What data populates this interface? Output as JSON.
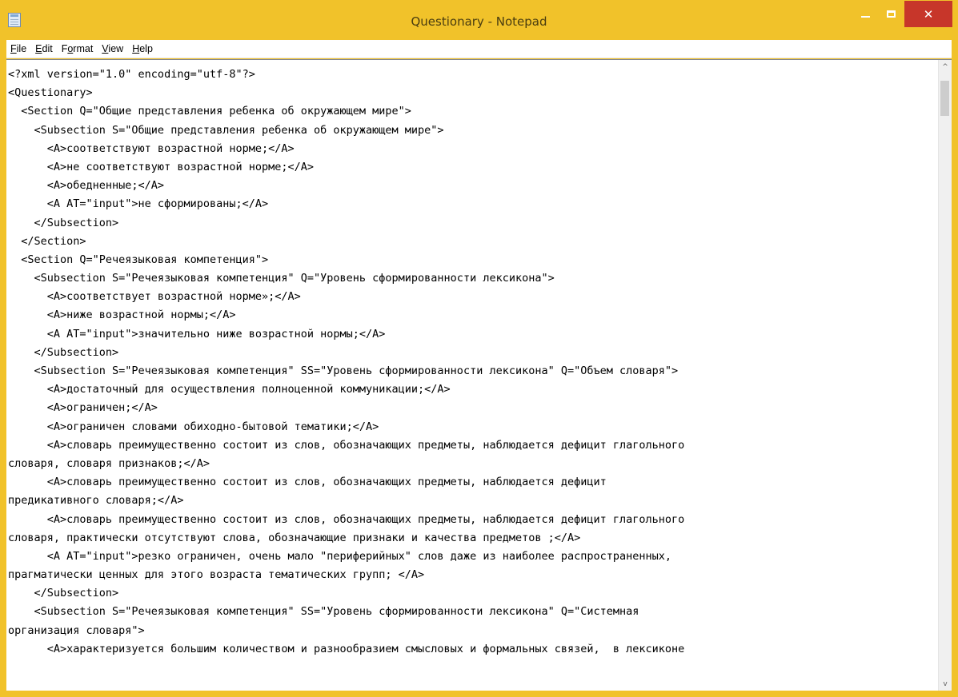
{
  "window": {
    "title": "Questionary - Notepad",
    "accent_color": "#f1c22a",
    "close_color": "#c7362a",
    "minimize_icon": "minimize-icon",
    "maximize_icon": "maximize-icon",
    "close_icon": "close-icon",
    "close_glyph": "✕"
  },
  "menu": {
    "items": [
      {
        "mnemonic": "F",
        "rest": "ile"
      },
      {
        "mnemonic": "E",
        "rest": "dit"
      },
      {
        "pre": "F",
        "mnemonic": "o",
        "rest": "rmat"
      },
      {
        "mnemonic": "V",
        "rest": "iew"
      },
      {
        "mnemonic": "H",
        "rest": "elp"
      }
    ]
  },
  "document": {
    "lines": [
      "<?xml version=\"1.0\" encoding=\"utf-8\"?>",
      "<Questionary>",
      "  <Section Q=\"Общие представления ребенка об окружающем мире\">",
      "    <Subsection S=\"Общие представления ребенка об окружающем мире\">",
      "      <A>соответствуют возрастной норме;</A>",
      "      <A>не соответствуют возрастной норме;</A>",
      "      <A>обедненные;</A>",
      "      <A AT=\"input\">не сформированы;</A>",
      "    </Subsection>",
      "  </Section>",
      "  <Section Q=\"Речеязыковая компетенция\">",
      "    <Subsection S=\"Речеязыковая компетенция\" Q=\"Уровень сформированности лексикона\">",
      "      <A>соответствует возрастной норме»;</A>",
      "      <A>ниже возрастной нормы;</A>",
      "      <A AT=\"input\">значительно ниже возрастной нормы;</A>",
      "    </Subsection>",
      "    <Subsection S=\"Речеязыковая компетенция\" SS=\"Уровень сформированности лексикона\" Q=\"Объем словаря\">",
      "      <A>достаточный для осуществления полноценной коммуникации;</A>",
      "      <A>ограничен;</A>",
      "      <A>ограничен словами обиходно-бытовой тематики;</A>",
      "      <A>словарь преимущественно состоит из слов, обозначающих предметы, наблюдается дефицит глагольного",
      "словаря, словаря признаков;</A>",
      "      <A>словарь преимущественно состоит из слов, обозначающих предметы, наблюдается дефицит",
      "предикативного словаря;</A>",
      "      <A>словарь преимущественно состоит из слов, обозначающих предметы, наблюдается дефицит глагольного",
      "словаря, практически отсутствуют слова, обозначающие признаки и качества предметов ;</A>",
      "      <A AT=\"input\">резко ограничен, очень мало \"периферийных\" слов даже из наиболее распространенных,",
      "прагматически ценных для этого возраста тематических групп; </A>",
      "    </Subsection>",
      "    <Subsection S=\"Речеязыковая компетенция\" SS=\"Уровень сформированности лексикона\" Q=\"Системная",
      "организация словаря\">",
      "      <A>характеризуется большим количеством и разнообразием смысловых и формальных связей,  в лексиконе"
    ]
  },
  "scrollbar": {
    "up_glyph": "^",
    "down_glyph": "v",
    "up_icon": "scroll-up-arrow-icon",
    "down_icon": "scroll-down-arrow-icon"
  }
}
